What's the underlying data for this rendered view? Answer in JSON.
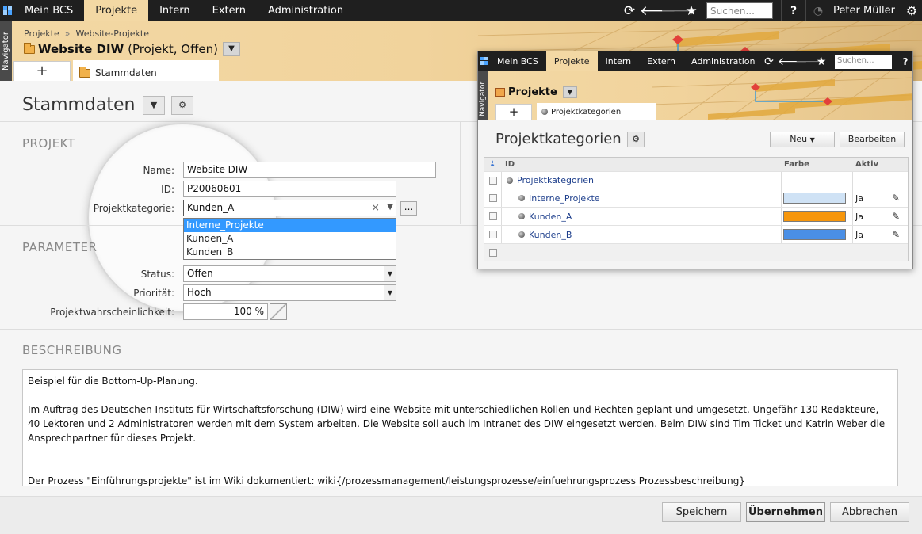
{
  "topnav": {
    "tabs": [
      {
        "label": "Mein BCS",
        "active": false
      },
      {
        "label": "Projekte",
        "active": true
      },
      {
        "label": "Intern",
        "active": false
      },
      {
        "label": "Extern",
        "active": false
      },
      {
        "label": "Administration",
        "active": false
      }
    ],
    "search_placeholder": "Suchen...",
    "help_label": "?",
    "user_name": "Peter Müller",
    "icons": [
      "refresh-icon",
      "back-arrow-icon",
      "forward-arrow-icon",
      "star-icon",
      "help-icon",
      "stopwatch-icon",
      "gear-icon"
    ]
  },
  "navigator_label": "Navigator",
  "breadcrumb": {
    "items": [
      "Projekte",
      "Website-Projekte"
    ],
    "separator": "»"
  },
  "header": {
    "title_bold": "Website DIW",
    "title_suffix": "(Projekt, Offen)",
    "add_tab_label": "+",
    "active_tab": "Stammdaten"
  },
  "page": {
    "title": "Stammdaten"
  },
  "projekt": {
    "section_title": "PROJEKT",
    "name_label": "Name:",
    "name_value": "Website DIW",
    "id_label": "ID:",
    "id_value": "P20060601",
    "kategorie_label": "Projektkategorie:",
    "kategorie_value": "Kunden_A",
    "clear_glyph": "×",
    "more_label": "...",
    "dropdown_options": [
      {
        "label": "Interne_Projekte",
        "selected": true
      },
      {
        "label": "Kunden_A",
        "selected": false
      },
      {
        "label": "Kunden_B",
        "selected": false
      }
    ]
  },
  "parameter": {
    "section_title": "PARAMETER",
    "status_label": "Status:",
    "status_value": "Offen",
    "prio_label": "Priorität:",
    "prio_value": "Hoch",
    "wahrsch_label": "Projektwahrscheinlichkeit:",
    "wahrsch_value": "100",
    "wahrsch_unit": "%"
  },
  "beschreibung": {
    "section_title": "BESCHREIBUNG",
    "paragraphs": [
      "Beispiel für die Bottom-Up-Planung.",
      "Im Auftrag des Deutschen Instituts für Wirtschaftsforschung (DIW) wird eine Website mit unterschiedlichen Rollen und Rechten geplant und umgesetzt. Ungefähr 130 Redakteure, 40 Lektoren und 2 Administratoren werden mit dem System arbeiten. Die Website soll auch im Intranet des DIW eingesetzt werden. Beim DIW sind Tim Ticket und Katrin Weber die Ansprechpartner für dieses Projekt.",
      "Der Prozess \"Einführungsprojekte\" ist im Wiki dokumentiert: wiki{/prozessmanagement/leistungsprozesse/einfuehrungsprozess Prozessbeschreibung}"
    ]
  },
  "footer": {
    "save": "Speichern",
    "apply": "Übernehmen",
    "cancel": "Abbrechen"
  },
  "inset": {
    "tabs": [
      {
        "label": "Mein BCS",
        "active": false
      },
      {
        "label": "Projekte",
        "active": true
      },
      {
        "label": "Intern",
        "active": false
      },
      {
        "label": "Extern",
        "active": false
      },
      {
        "label": "Administration",
        "active": false
      }
    ],
    "search_placeholder": "Suchen...",
    "help_label": "?",
    "navigator_label": "Navigator",
    "header_title": "Projekte",
    "add_tab_label": "+",
    "active_tab": "Projektkategorien",
    "page_title": "Projektkategorien",
    "btn_new": "Neu",
    "btn_edit": "Bearbeiten",
    "table": {
      "columns": [
        "ID",
        "Farbe",
        "Aktiv"
      ],
      "root": "Projektkategorien",
      "rows": [
        {
          "id": "Interne_Projekte",
          "color": "#cfe2f5",
          "aktiv": "Ja"
        },
        {
          "id": "Kunden_A",
          "color": "#f6960c",
          "aktiv": "Ja"
        },
        {
          "id": "Kunden_B",
          "color": "#4a8fe6",
          "aktiv": "Ja"
        }
      ]
    }
  },
  "colors": {
    "accent": "#f3d8a4",
    "topbar": "#1f1f1f",
    "selection": "#3399ff",
    "link": "#1e3f8c"
  }
}
